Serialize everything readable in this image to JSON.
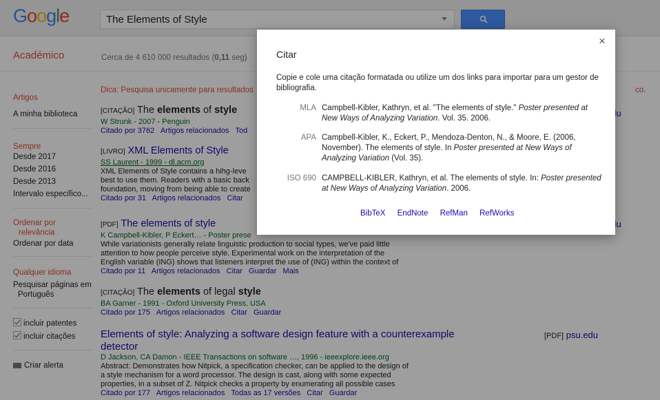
{
  "header": {
    "logo": "Google",
    "search_value": "The Elements of Style"
  },
  "subheader": {
    "brand": "Académico",
    "result_count": "Cerca de 4 610 000 resultados (0,11 seg)"
  },
  "sidebar": {
    "artigos": "Artigos",
    "biblioteca": "A minha biblioteca",
    "sempre": "Sempre",
    "desde2017": "Desde 2017",
    "desde2016": "Desde 2016",
    "desde2013": "Desde 2013",
    "intervalo": "Intervalo específico...",
    "ordenar_rel_1": "Ordenar por",
    "ordenar_rel_2": "relevância",
    "ordenar_data": "Ordenar por data",
    "qualquer_idioma": "Qualquer idioma",
    "pesquisar_1": "Pesquisar páginas em",
    "pesquisar_2": "Português",
    "patentes": "incluir patentes",
    "citacoes": "incluir citações",
    "criar_alerta": "Criar alerta"
  },
  "hint": {
    "text": "Dica: Pesquisa unicamente para resultados",
    "suffix": "co."
  },
  "results": [
    {
      "tag": "[CITAÇÃO]",
      "title_pre": "The ",
      "title_b1": "elements",
      "title_mid": " of ",
      "title_b2": "style",
      "authors": "W Strunk - 2007 - Penguin",
      "links": "Citado por 3762   Artigos relacionados   Tod",
      "right": "edu"
    },
    {
      "tag": "[LIVRO]",
      "title": "XML Elements of Style",
      "authors": "SS Laurent - 1999 - dl.acm.org",
      "snippet1": "XML Elements of Style contains a hihg-leve",
      "snippet2": "best to use them. Readers with a basic back",
      "snippet3": "foundation, moving from being able to create",
      "links": "Citado por 31   Artigos relacionados   Citar"
    },
    {
      "tag": "[PDF]",
      "title": "The elements of style",
      "authors": "K Campbell-Kibler, P Eckert… - Poster prese",
      "snippet1": "While variationists generally relate linguistic production to social types, we've paid little",
      "snippet2": "attention to how people perceive style. Experimental work on the interpretation of the",
      "snippet3": "English variable (ING) shows that listeners interpret the use of (ING) within the context of",
      "links": "Citado por 11   Artigos relacionados   Citar   Guardar   Mais",
      "right": "edu"
    },
    {
      "tag": "[CITAÇÃO]",
      "title_pre": "The ",
      "title_b1": "elements",
      "title_mid": " of legal ",
      "title_b2": "style",
      "authors": "BA Garner - 1991 - Oxford University Press, USA",
      "links": "Citado por 175   Artigos relacionados   Citar   Guardar"
    },
    {
      "title1": "Elements of style: Analyzing a software design feature with a counterexample",
      "title2": "detector",
      "authors": "D Jackson, CA Damon - IEEE Transactions on software …, 1996 - ieeexplore.ieee.org",
      "snippet1": "Abstract: Demonstrates how Nitpick, a specification checker, can be applied to the design of",
      "snippet2": "a style mechanism for a word processor. The design is cast, along with some expected",
      "snippet3": "properties, in a subset of Z. Nitpick checks a property by enumerating all possible cases",
      "links": "Citado por 177   Artigos relacionados   Todas as 17 versões   Citar   Guardar",
      "right_tag": "[PDF]",
      "right": "psu.edu"
    }
  ],
  "modal": {
    "title": "Citar",
    "close": "×",
    "desc": "Copie e cole uma citação formatada ou utilize um dos links para importar para um gestor de bibliografia.",
    "citations": [
      {
        "label": "MLA",
        "text_pre": "Campbell-Kibler, Kathryn, et al. \"The elements of style.\" ",
        "text_em": "Poster presented at New Ways of Analyzing Variation",
        "text_post": ". Vol. 35. 2006."
      },
      {
        "label": "APA",
        "text_pre": "Campbell-Kibler, K., Eckert, P., Mendoza-Denton, N., & Moore, E. (2006, November). The elements of style. In ",
        "text_em": "Poster presented at New Ways of Analyzing Variation",
        "text_post": " (Vol. 35)."
      },
      {
        "label": "ISO 690",
        "text_pre": "CAMPBELL-KIBLER, Kathryn, et al. The elements of style. In: ",
        "text_em": "Poster presented at New Ways of Analyzing Variation",
        "text_post": ". 2006."
      }
    ],
    "exports": [
      "BibTeX",
      "EndNote",
      "RefMan",
      "RefWorks"
    ]
  },
  "colors": {
    "accent_red": "#dd4b39",
    "link_blue": "#1a0dab",
    "green": "#006621",
    "button_blue": "#4d90fe"
  }
}
